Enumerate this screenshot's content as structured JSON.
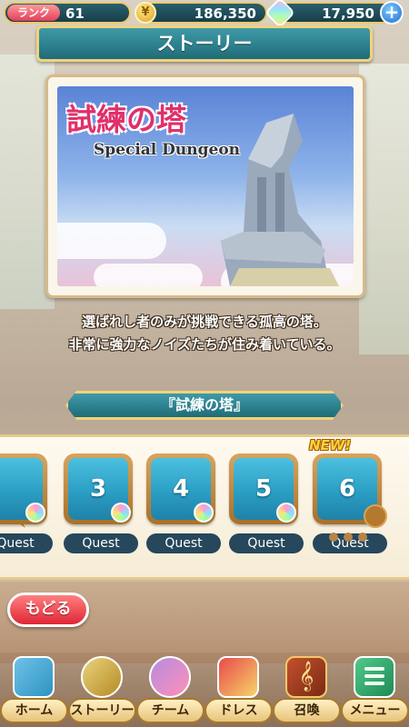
{
  "status": {
    "rank_label": "ランク",
    "rank_value": "61",
    "coins": "186,350",
    "gems": "17,950",
    "plus": "+"
  },
  "header": {
    "title": "ストーリー"
  },
  "dungeon": {
    "title_jp": "試練の塔",
    "title_en": "Special Dungeon",
    "description_line1": "選ばれし者のみが挑戦できる孤高の塔。",
    "description_line2": "非常に強力なノイズたちが住み着いている。"
  },
  "section": {
    "title": "『試練の塔』"
  },
  "quests": [
    {
      "number": "",
      "label": "Quest"
    },
    {
      "number": "3",
      "label": "Quest"
    },
    {
      "number": "4",
      "label": "Quest"
    },
    {
      "number": "5",
      "label": "Quest"
    },
    {
      "number": "6",
      "label": "Quest",
      "badge": "NEW!"
    }
  ],
  "back_button": {
    "label": "もどる"
  },
  "nav": [
    {
      "label": "ホーム",
      "icon": "map-pin-icon"
    },
    {
      "label": "ストーリー",
      "icon": "trophy-icon"
    },
    {
      "label": "チーム",
      "icon": "team-icon"
    },
    {
      "label": "ドレス",
      "icon": "dress-icon"
    },
    {
      "label": "召喚",
      "icon": "music-book-icon",
      "glyph": "𝄞"
    },
    {
      "label": "メニュー",
      "icon": "menu-icon"
    }
  ],
  "colors": {
    "banner_teal": "#1f6c78",
    "gold_border": "#f2d27a",
    "back_red": "#e02636",
    "tile_blue": "#2b9ec4"
  }
}
